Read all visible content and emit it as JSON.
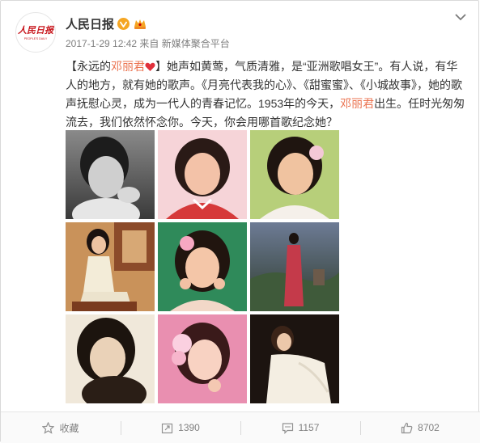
{
  "post": {
    "username": "人民日报",
    "timestamp": "2017-1-29 12:42",
    "source": "来自 新媒体聚合平台",
    "avatar_logo_text": "人民日报",
    "avatar_logo_sub": "PEOPLE'S DAILY",
    "text": {
      "p1": "【永远的",
      "p2_hl": "邓丽君",
      "p3": "】她声如黄莺，气质清雅，是“亚洲歌唱女王”。有人说，有华人的地方，就有她的歌声。《月亮代表我的心》、《甜蜜蜜》、《小城故事》，她的歌声抚慰心灵，成为一代人的青春记忆。1953年的今天，",
      "p4_hl": "邓丽君",
      "p5": "出生。任时光匆匆流去，我们依然怀念你。今天，你会用哪首歌纪念她？"
    },
    "images": [
      {
        "name": "bw-portrait-child"
      },
      {
        "name": "pink-portrait"
      },
      {
        "name": "green-portrait"
      },
      {
        "name": "qipao-sitting"
      },
      {
        "name": "flower-smile"
      },
      {
        "name": "red-dress-field"
      },
      {
        "name": "sepia-portrait"
      },
      {
        "name": "pink-flowers-hair"
      },
      {
        "name": "white-gown"
      }
    ]
  },
  "actions": {
    "favorite": "收藏",
    "repost": "1390",
    "comment": "1157",
    "like": "8702"
  },
  "colors": {
    "highlight": "#eb7350",
    "meta": "#808080",
    "verified": "#f5a623"
  }
}
